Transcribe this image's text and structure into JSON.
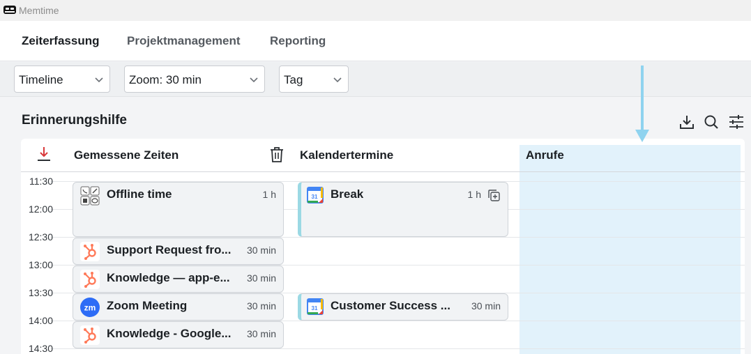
{
  "app": {
    "title": "Memtime"
  },
  "nav": {
    "items": [
      {
        "label": "Zeiterfassung",
        "active": true
      },
      {
        "label": "Projektmanagement",
        "active": false
      },
      {
        "label": "Reporting",
        "active": false
      }
    ]
  },
  "toolbar": {
    "view_select": "Timeline",
    "zoom_select": "Zoom: 30 min",
    "range_select": "Tag"
  },
  "main": {
    "title": "Erinnerungshilfe",
    "tools": [
      "download-icon",
      "search-icon",
      "filter-sliders-icon"
    ],
    "columns": {
      "measured": "Gemessene Zeiten",
      "calendar": "Kalendertermine",
      "calls": "Anrufe"
    },
    "times": [
      "11:30",
      "12:00",
      "12:30",
      "13:00",
      "13:30",
      "14:00",
      "14:30"
    ],
    "measured_entries": [
      {
        "title": "Offline time",
        "duration": "1 h",
        "icon": "offline-apps-icon"
      },
      {
        "title": "Support Request fro...",
        "duration": "30 min",
        "icon": "hubspot-icon"
      },
      {
        "title": "Knowledge — app-e...",
        "duration": "30 min",
        "icon": "hubspot-icon"
      },
      {
        "title": "Zoom Meeting",
        "duration": "30 min",
        "icon": "zoom-icon"
      },
      {
        "title": "Knowledge - Google...",
        "duration": "30 min",
        "icon": "hubspot-icon"
      }
    ],
    "calendar_entries": [
      {
        "title": "Break",
        "duration": "1 h",
        "icon": "google-calendar-icon"
      },
      {
        "title": "Customer Success ...",
        "duration": "30 min",
        "icon": "google-calendar-icon"
      }
    ]
  },
  "colors": {
    "accent_calls": "#e2f2fb",
    "calendar_border": "#9bd9e4",
    "download_red": "#d9383a",
    "hubspot": "#ff7a59",
    "zoom": "#2d6cf6"
  }
}
